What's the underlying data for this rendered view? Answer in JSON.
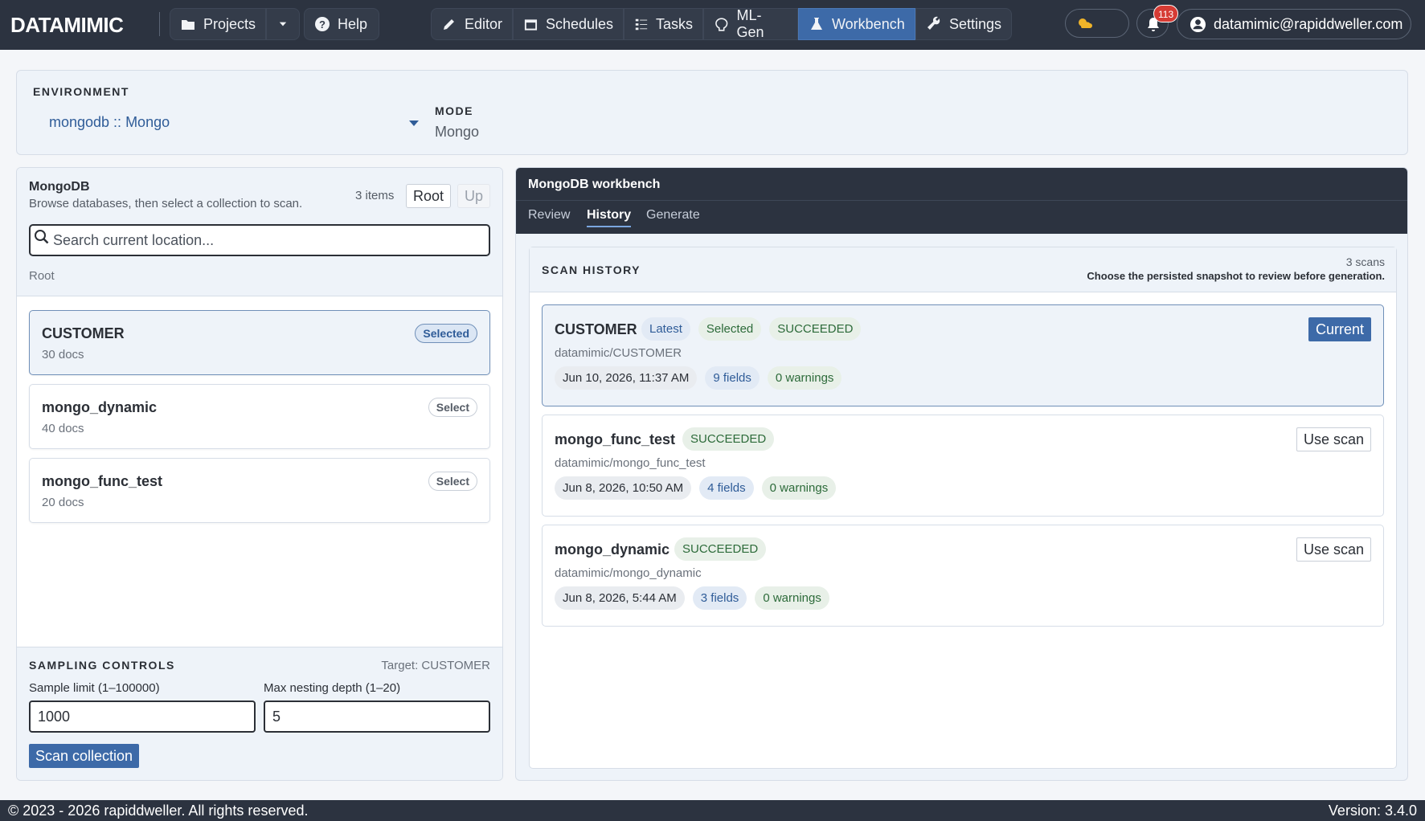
{
  "app": {
    "logo": "DATAMIMIC",
    "nav": {
      "projects": "Projects",
      "help": "Help",
      "editor": "Editor",
      "schedules": "Schedules",
      "tasks": "Tasks",
      "mlgen": "ML-Gen",
      "workbench": "Workbench",
      "settings": "Settings"
    },
    "notifications": "113",
    "user": "datamimic@rapiddweller.com"
  },
  "environment": {
    "label": "ENVIRONMENT",
    "value": "mongodb :: Mongo",
    "mode_label": "MODE",
    "mode_value": "Mongo"
  },
  "browser": {
    "title": "MongoDB",
    "subtitle": "Browse databases, then select a collection to scan.",
    "count": "3 items",
    "root_btn": "Root",
    "up_btn": "Up",
    "search_placeholder": "Search current location...",
    "breadcrumb": "Root",
    "items": [
      {
        "name": "CUSTOMER",
        "docs": "30 docs",
        "tag": "Selected"
      },
      {
        "name": "mongo_dynamic",
        "docs": "40 docs",
        "tag": "Select"
      },
      {
        "name": "mongo_func_test",
        "docs": "20 docs",
        "tag": "Select"
      }
    ]
  },
  "sampling": {
    "label": "SAMPLING CONTROLS",
    "target": "Target: CUSTOMER",
    "limit_label": "Sample limit (1–100000)",
    "limit_value": "1000",
    "depth_label": "Max nesting depth (1–20)",
    "depth_value": "5",
    "scan_btn": "Scan collection"
  },
  "workbench": {
    "title": "MongoDB workbench",
    "tabs": [
      "Review",
      "History",
      "Generate"
    ],
    "active_tab": "History",
    "history_label": "SCAN HISTORY",
    "scan_count": "3 scans",
    "hint": "Choose the persisted snapshot to review before generation.",
    "scans": [
      {
        "name": "CUSTOMER",
        "chips": [
          "Latest",
          "Selected",
          "SUCCEEDED"
        ],
        "path": "datamimic/CUSTOMER",
        "date": "Jun 10, 2026, 11:37 AM",
        "fields": "9 fields",
        "warnings": "0 warnings",
        "action": "Current"
      },
      {
        "name": "mongo_func_test",
        "chips": [
          "SUCCEEDED"
        ],
        "path": "datamimic/mongo_func_test",
        "date": "Jun 8, 2026, 10:50 AM",
        "fields": "4 fields",
        "warnings": "0 warnings",
        "action": "Use scan"
      },
      {
        "name": "mongo_dynamic",
        "chips": [
          "SUCCEEDED"
        ],
        "path": "datamimic/mongo_dynamic",
        "date": "Jun 8, 2026, 5:44 AM",
        "fields": "3 fields",
        "warnings": "0 warnings",
        "action": "Use scan"
      }
    ]
  },
  "footer": {
    "copyright": "© 2023 - 2026 rapiddweller. All rights reserved.",
    "version": "Version: 3.4.0"
  },
  "colors": {
    "navbar": "#2c3340",
    "accent": "#3d6aa8",
    "success": "#2d6b3a",
    "danger": "#d63b34"
  }
}
